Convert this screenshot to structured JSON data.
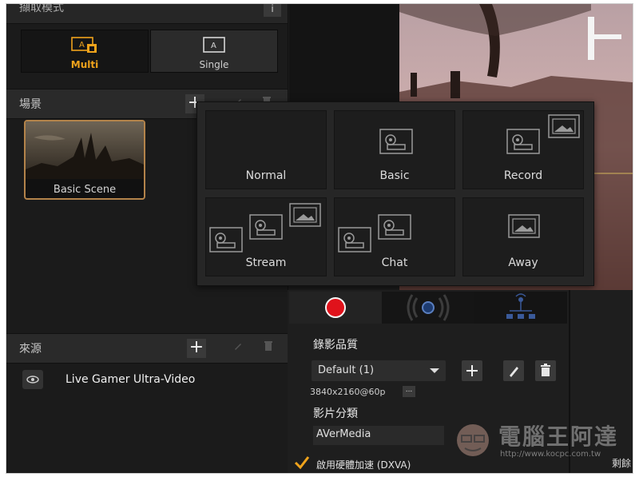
{
  "capture": {
    "title": "擷取模式",
    "info_label": "i",
    "multi_label": "Multi",
    "single_label": "Single",
    "icon_letter": "A"
  },
  "scenes": {
    "title": "場景",
    "add_label": "+",
    "items": [
      {
        "label": "Basic Scene"
      }
    ]
  },
  "sources": {
    "title": "來源",
    "add_label": "+",
    "items": [
      {
        "label": "Live Gamer Ultra-Video"
      }
    ]
  },
  "layout_popup": {
    "tiles": [
      {
        "label": "Normal"
      },
      {
        "label": "Basic"
      },
      {
        "label": "Record"
      },
      {
        "label": "Stream"
      },
      {
        "label": "Chat"
      },
      {
        "label": "Away"
      }
    ]
  },
  "record": {
    "quality_label": "錄影品質",
    "profile_value": "Default (1)",
    "resolution": "3840x2160@60p",
    "more_label": "...",
    "category_label": "影片分類",
    "category_value": "AVerMedia",
    "hw_accel_label": "啟用硬體加速 (DXVA)"
  },
  "watermark": {
    "text": "電腦王阿達",
    "url": "http://www.kocpc.com.tw"
  },
  "edge_text": "剩餘",
  "colors": {
    "accent": "#f0a31b",
    "record_red": "#e0121b",
    "panel": "#1d1d1d",
    "scene_border": "#b3834a"
  }
}
